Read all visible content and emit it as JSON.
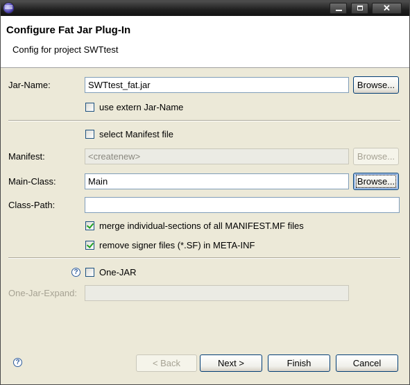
{
  "window": {
    "app_icon": "eclipse-icon"
  },
  "header": {
    "title": "Configure Fat Jar Plug-In",
    "subtitle": "Config for project SWTtest"
  },
  "form": {
    "jar_name": {
      "label": "Jar-Name:",
      "value": "SWTtest_fat.jar",
      "browse": "Browse..."
    },
    "use_extern": {
      "label": "use extern Jar-Name",
      "checked": false
    },
    "select_manifest": {
      "label": "select Manifest file",
      "checked": false
    },
    "manifest": {
      "label": "Manifest:",
      "placeholder": "<createnew>",
      "browse": "Browse...",
      "disabled": true
    },
    "main_class": {
      "label": "Main-Class:",
      "value": "Main",
      "browse": "Browse..."
    },
    "class_path": {
      "label": "Class-Path:",
      "value": ""
    },
    "merge_sections": {
      "label": "merge individual-sections of all MANIFEST.MF files",
      "checked": true
    },
    "remove_signer": {
      "label": "remove signer files (*.SF) in META-INF",
      "checked": true
    },
    "one_jar": {
      "label": "One-JAR",
      "checked": false
    },
    "one_jar_expand": {
      "label": "One-Jar-Expand:",
      "value": "",
      "disabled": true
    }
  },
  "footer": {
    "back": "< Back",
    "next": "Next >",
    "finish": "Finish",
    "cancel": "Cancel"
  }
}
